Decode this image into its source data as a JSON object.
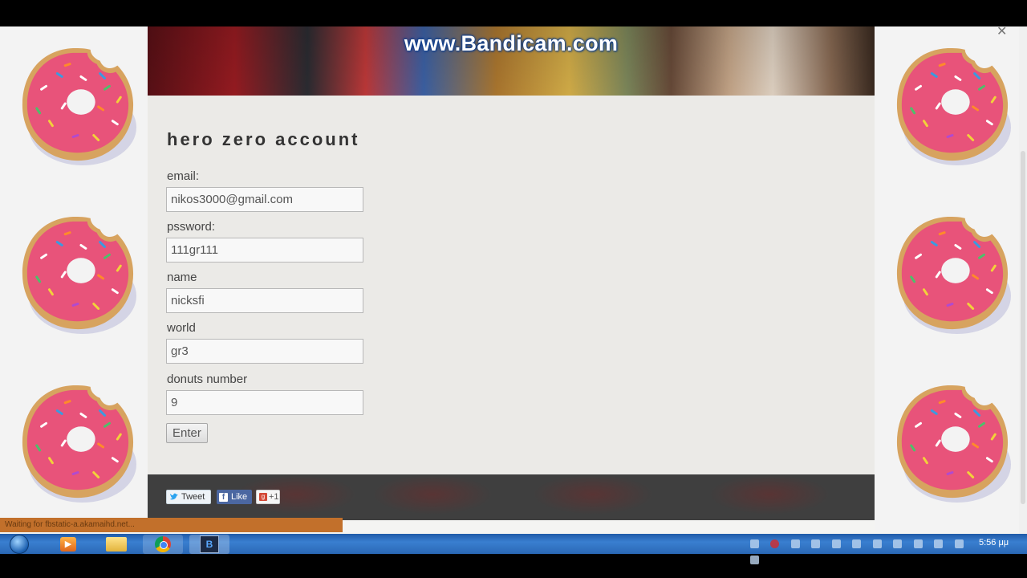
{
  "banner": {
    "watermark": "www.Bandicam.com"
  },
  "page": {
    "title": "hero zero account"
  },
  "form": {
    "email": {
      "label": "email:",
      "value": "nikos3000@gmail.com"
    },
    "password": {
      "label": "pssword:",
      "value": "111gr111"
    },
    "name": {
      "label": "name",
      "value": "nicksfi"
    },
    "world": {
      "label": "world",
      "value": "gr3"
    },
    "donuts": {
      "label": "donuts number",
      "value": "9"
    },
    "submit_label": "Enter"
  },
  "social": {
    "tweet_label": "Tweet",
    "like_label": "Like",
    "gplus_label": "+1"
  },
  "browser": {
    "status_text": "Waiting for fbstatic-a.akamaihd.net..."
  },
  "taskbar": {
    "clock": "5:56 μμ",
    "items": [
      "start-orb",
      "media-player",
      "file-explorer",
      "chrome",
      "bandicam"
    ]
  },
  "colors": {
    "page_bg": "#ebeae7",
    "footer_bg": "#3f3f3f",
    "donut_frosting": "#e8537a",
    "donut_dough": "#d7a35f",
    "status_bar": "#c2702b"
  }
}
